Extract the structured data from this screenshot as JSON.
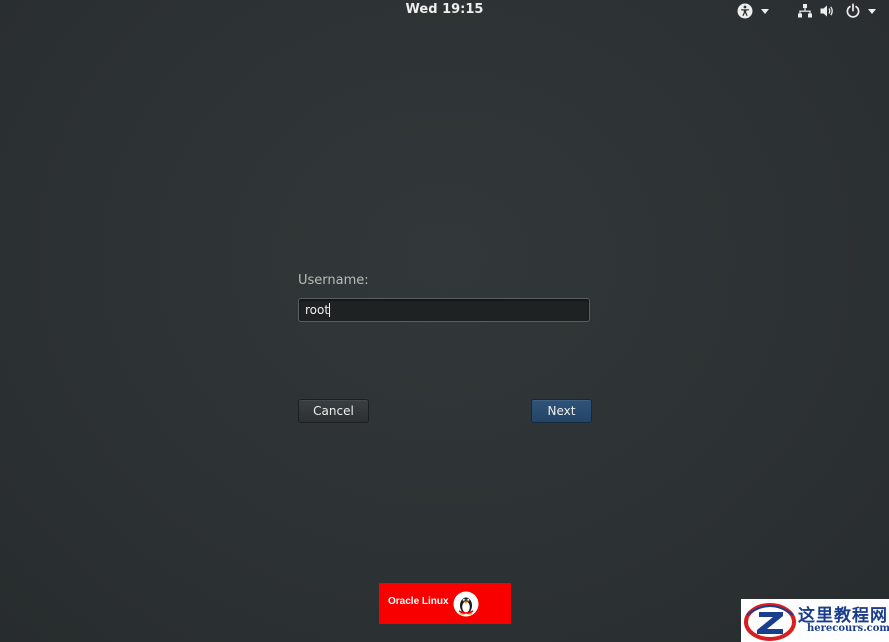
{
  "topbar": {
    "clock": "Wed 19:15",
    "icons": {
      "accessibility": "accessibility-icon",
      "network": "network-wired-icon",
      "volume": "volume-icon",
      "power": "power-icon"
    },
    "text_color": "#eeeeec"
  },
  "login": {
    "prompt_label": "Username:",
    "username_value": "root",
    "cancel_label": "Cancel",
    "next_label": "Next",
    "next_color": "#2a4b6e"
  },
  "branding": {
    "oracle_label": "Oracle Linux",
    "oracle_color": "#f80000",
    "mascot_icon": "tux-penguin-icon"
  },
  "watermark": {
    "title": "这里教程网",
    "url": "herecours.com",
    "logo_icon": "z-logo-icon"
  },
  "colors": {
    "background": "#2e3436"
  }
}
